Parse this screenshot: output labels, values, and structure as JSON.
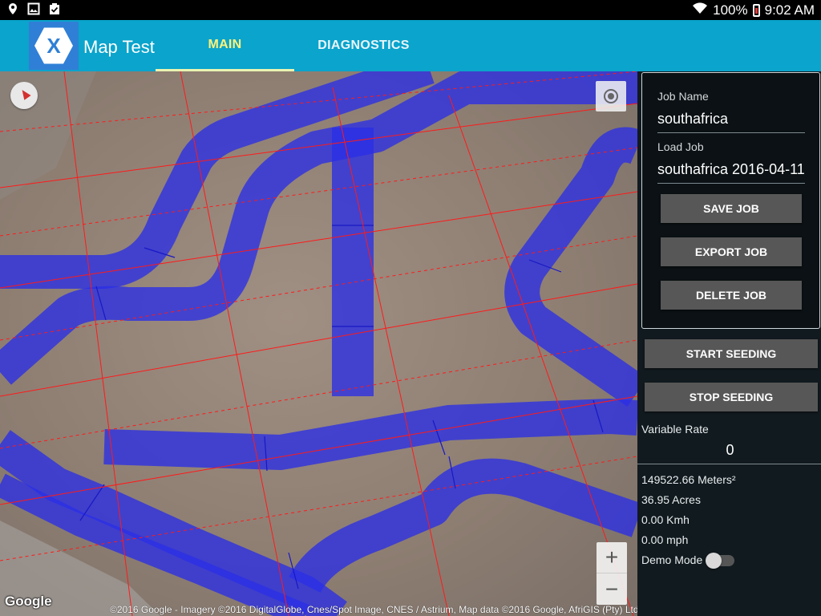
{
  "status": {
    "battery": "100%",
    "time": "9:02 AM"
  },
  "appbar": {
    "title": "Map Test",
    "logo_letter": "X",
    "tabs": [
      {
        "label": "MAIN",
        "selected": true
      },
      {
        "label": "DIAGNOSTICS",
        "selected": false
      }
    ]
  },
  "map": {
    "google": "Google",
    "attribution": "©2016 Google - Imagery ©2016 DigitalGlobe, Cnes/Spot Image, CNES / Astrium, Map data ©2016 Google, AfriGIS (Pty) Ltd",
    "zoom_in": "+",
    "zoom_out": "−"
  },
  "panel": {
    "job_name_label": "Job Name",
    "job_name_value": "southafrica",
    "load_job_label": "Load Job",
    "load_job_value": "southafrica 2016-04-11",
    "save_label": "SAVE JOB",
    "export_label": "EXPORT JOB",
    "delete_label": "DELETE JOB",
    "start_label": "START SEEDING",
    "stop_label": "STOP SEEDING",
    "variable_rate_label": "Variable Rate",
    "variable_rate_value": "0",
    "area_m2": "149522.66 Meters²",
    "area_acres": "36.95 Acres",
    "speed_kmh": "0.00 Kmh",
    "speed_mph": "0.00 mph",
    "demo_mode_label": "Demo Mode",
    "demo_mode_on": false
  },
  "colors": {
    "appbar": "#0aa4cc",
    "tab_selected": "#fff27a",
    "coverage": "#2a2ee6",
    "grid": "#ff0000",
    "panel": "#111a1f"
  }
}
